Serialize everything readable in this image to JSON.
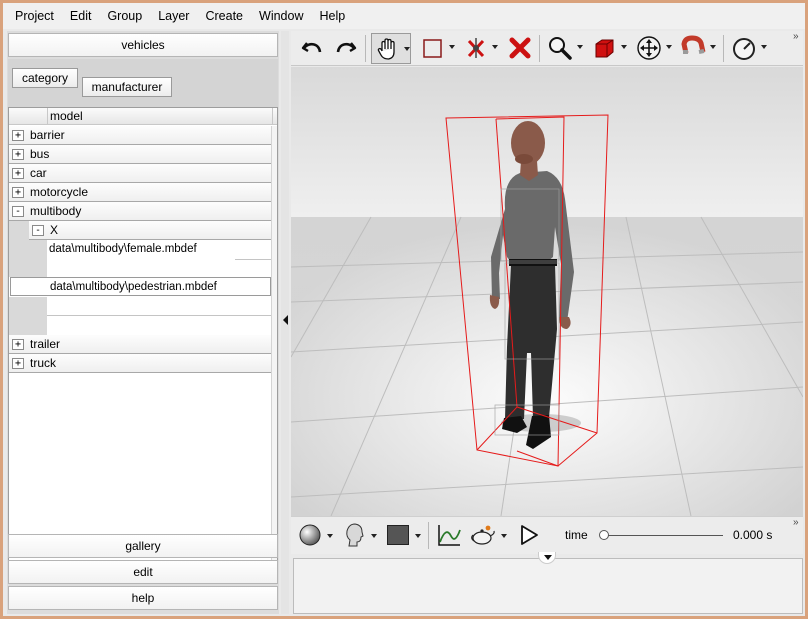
{
  "menu": [
    "Project",
    "Edit",
    "Group",
    "Layer",
    "Create",
    "Window",
    "Help"
  ],
  "left_panel": {
    "top_button": "vehicles",
    "tabs": [
      "category",
      "manufacturer"
    ],
    "column_header": "model",
    "tree": [
      {
        "label": "barrier",
        "toggle": "+"
      },
      {
        "label": "bus",
        "toggle": "+"
      },
      {
        "label": "car",
        "toggle": "+"
      },
      {
        "label": "motorcycle",
        "toggle": "+"
      },
      {
        "label": "multibody",
        "toggle": "-"
      },
      {
        "label": "X",
        "toggle": "-"
      },
      {
        "label": "data\\multibody\\female.mbdef"
      },
      {
        "label": "data\\multibody\\pedestrian.mbdef"
      },
      {
        "label": "trailer",
        "toggle": "+"
      },
      {
        "label": "truck",
        "toggle": "+"
      }
    ],
    "bottom_buttons": [
      "gallery",
      "edit",
      "help"
    ]
  },
  "toolbar_icons": [
    "undo-icon",
    "redo-icon",
    "hand-pan-icon",
    "rectangle-select-icon",
    "ignore-object-icon",
    "delete-icon",
    "zoom-icon",
    "red-cube-icon",
    "move-icon",
    "magnet-icon",
    "gauge-icon"
  ],
  "bottom_toolbar": {
    "icons": [
      "shading-sphere-icon",
      "head-icon",
      "color-swatch-icon",
      "curve-icon",
      "teapot-icon",
      "play-icon"
    ],
    "time_label": "time",
    "time_value": "0.000 s"
  },
  "colors": {
    "bounding_box": "#e51b1b",
    "accent_red": "#cc1111",
    "window_border": "#d9a27c"
  }
}
